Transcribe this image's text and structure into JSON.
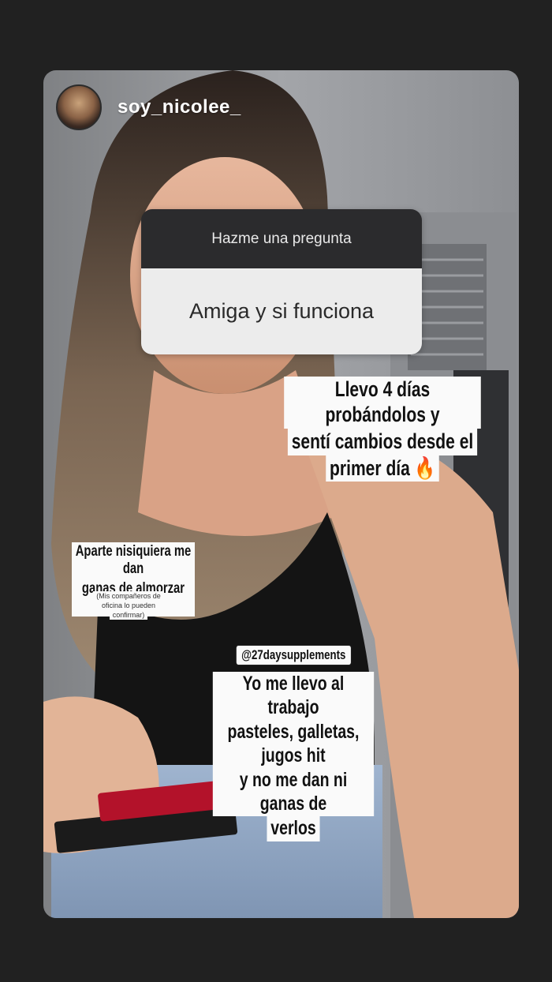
{
  "story": {
    "username": "soy_nicolee_"
  },
  "question_box": {
    "header": "Hazme una pregunta",
    "answer": "Amiga y si funciona"
  },
  "stickers": {
    "main_text": [
      "Llevo 4 días probándolos y",
      "sentí cambios desde el",
      "primer día 🔥"
    ],
    "side_text": [
      "Aparte nisiquiera me dan",
      "ganas de almorzar 😖"
    ],
    "side_note": [
      "(Mis compañeros de",
      "oficina lo pueden",
      "confirmar)"
    ],
    "mention": "@27daysupplements",
    "bottom_text": [
      "Yo me llevo al trabajo",
      "pasteles, galletas, jugos hit",
      "y no me dan ni ganas de",
      "verlos"
    ]
  },
  "colors": {
    "page_bg": "#212121",
    "question_header_bg": "#2b2b2d",
    "question_body_bg": "#ececec",
    "sticker_bg": "#fafafa"
  }
}
